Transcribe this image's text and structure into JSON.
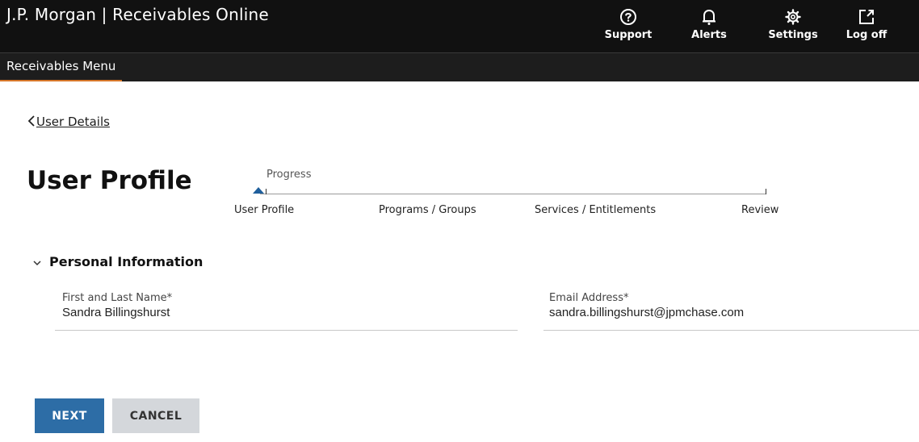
{
  "header": {
    "brand": "J.P. Morgan | Receivables Online",
    "actions": [
      {
        "label": "Support",
        "icon": "help-circle-icon"
      },
      {
        "label": "Alerts",
        "icon": "bell-icon"
      },
      {
        "label": "Settings",
        "icon": "gear-icon"
      },
      {
        "label": "Log off",
        "icon": "external-link-icon"
      }
    ]
  },
  "subnav": {
    "active_label": "Receivables Menu",
    "accent_color": "#d7772a"
  },
  "back_link": {
    "label": "User Details"
  },
  "page": {
    "title": "User Profile"
  },
  "progress": {
    "label": "Progress",
    "steps": [
      "User Profile",
      "Programs / Groups",
      "Services / Entitlements",
      "Review"
    ],
    "current_step": "User Profile"
  },
  "section": {
    "title": "Personal Information",
    "expanded": true
  },
  "form": {
    "name_label": "First and Last Name*",
    "name_value": "Sandra Billingshurst",
    "email_label": "Email Address*",
    "email_value": "sandra.billingshurst@jpmchase.com"
  },
  "buttons": {
    "next": "NEXT",
    "cancel": "CANCEL",
    "primary_color": "#2d6da6"
  }
}
